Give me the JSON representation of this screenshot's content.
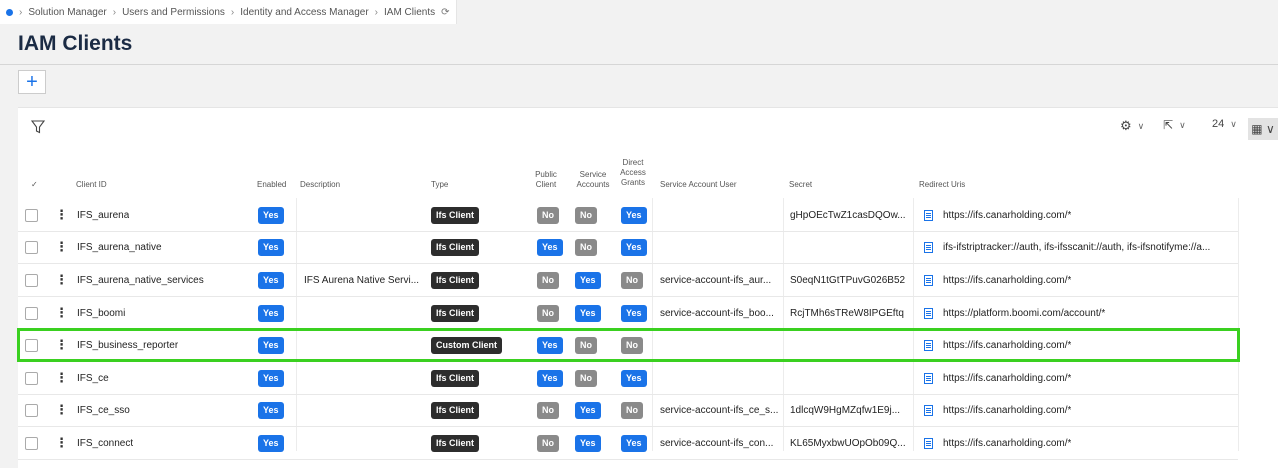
{
  "breadcrumb": [
    "Solution Manager",
    "Users and Permissions",
    "Identity and Access Manager",
    "IAM Clients"
  ],
  "title": "IAM Clients",
  "toolbar": {
    "page_size": "24"
  },
  "columns": {
    "client_id": "Client ID",
    "enabled": "Enabled",
    "description": "Description",
    "type": "Type",
    "public_client": "Public Client",
    "service_accounts": "Service Accounts",
    "direct_access_grants": "Direct Access Grants",
    "service_account_user": "Service Account User",
    "secret": "Secret",
    "redirect_uris": "Redirect Uris"
  },
  "rows": [
    {
      "client_id": "IFS_aurena",
      "enabled": "Yes",
      "description": "",
      "type": "Ifs Client",
      "public": "No",
      "service": "No",
      "direct": "Yes",
      "sa_user": "",
      "secret": "gHpOEcTwZ1casDQOw...",
      "redirect": "https://ifs.canarholding.com/*"
    },
    {
      "client_id": "IFS_aurena_native",
      "enabled": "Yes",
      "description": "",
      "type": "Ifs Client",
      "public": "Yes",
      "service": "No",
      "direct": "Yes",
      "sa_user": "",
      "secret": "",
      "redirect": "ifs-ifstriptracker://auth, ifs-ifsscanit://auth, ifs-ifsnotifyme://a..."
    },
    {
      "client_id": "IFS_aurena_native_services",
      "enabled": "Yes",
      "description": "IFS Aurena Native Servi...",
      "type": "Ifs Client",
      "public": "No",
      "service": "Yes",
      "direct": "No",
      "sa_user": "service-account-ifs_aur...",
      "secret": "S0eqN1tGtTPuvG026B52",
      "redirect": "https://ifs.canarholding.com/*"
    },
    {
      "client_id": "IFS_boomi",
      "enabled": "Yes",
      "description": "",
      "type": "Ifs Client",
      "public": "No",
      "service": "Yes",
      "direct": "Yes",
      "sa_user": "service-account-ifs_boo...",
      "secret": "RcjTMh6sTReW8IPGEftq",
      "redirect": "https://platform.boomi.com/account/*"
    },
    {
      "client_id": "IFS_business_reporter",
      "enabled": "Yes",
      "description": "",
      "type": "Custom Client",
      "public": "Yes",
      "service": "No",
      "direct": "No",
      "sa_user": "",
      "secret": "",
      "redirect": "https://ifs.canarholding.com/*"
    },
    {
      "client_id": "IFS_ce",
      "enabled": "Yes",
      "description": "",
      "type": "Ifs Client",
      "public": "Yes",
      "service": "No",
      "direct": "Yes",
      "sa_user": "",
      "secret": "",
      "redirect": "https://ifs.canarholding.com/*"
    },
    {
      "client_id": "IFS_ce_sso",
      "enabled": "Yes",
      "description": "",
      "type": "Ifs Client",
      "public": "No",
      "service": "Yes",
      "direct": "No",
      "sa_user": "service-account-ifs_ce_s...",
      "secret": "1dlcqW9HgMZqfw1E9j...",
      "redirect": "https://ifs.canarholding.com/*"
    },
    {
      "client_id": "IFS_connect",
      "enabled": "Yes",
      "description": "",
      "type": "Ifs Client",
      "public": "No",
      "service": "Yes",
      "direct": "Yes",
      "sa_user": "service-account-ifs_con...",
      "secret": "KL65MyxbwUOpOb09Q...",
      "redirect": "https://ifs.canarholding.com/*"
    }
  ]
}
